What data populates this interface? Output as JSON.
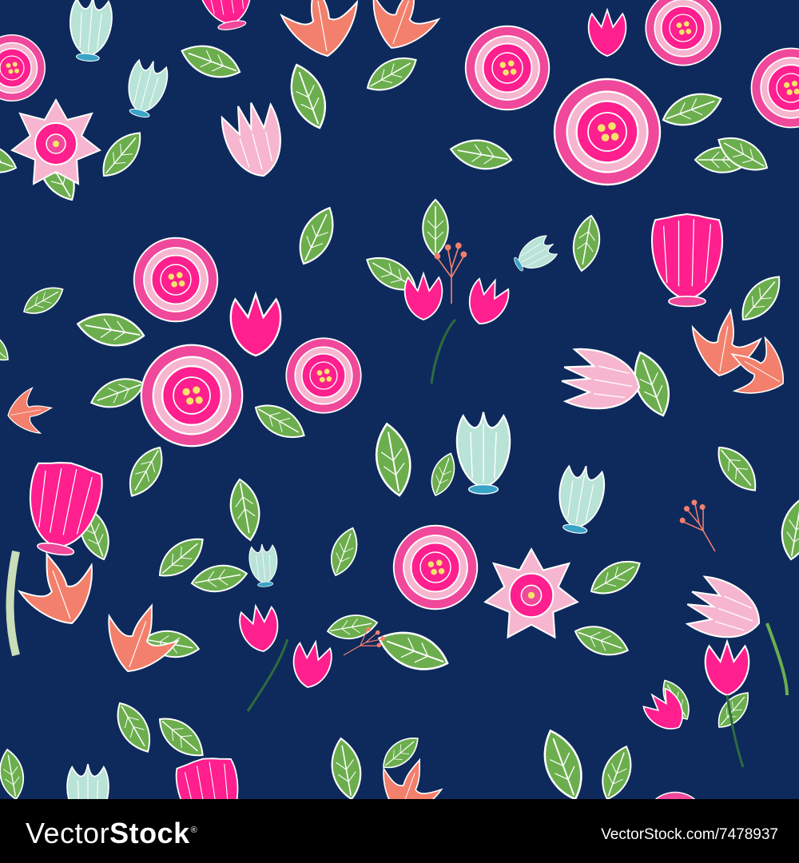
{
  "image": {
    "subject": "seamless floral pattern",
    "background_color": "#0e2a5c",
    "palette": {
      "hot_pink": "#ff1f8e",
      "rose": "#f0489a",
      "light_pink": "#f7b6cf",
      "salmon": "#f3806c",
      "mint": "#b8e3d6",
      "leaf_green": "#6cae4e",
      "dark_green": "#2f6b3e",
      "yellow": "#f7e36c",
      "outline": "#ffffff"
    }
  },
  "watermark": {
    "brand_prefix": "Vector",
    "brand_suffix": "Stock",
    "trademark": "®",
    "url": "VectorStock.com/7478937",
    "bar_color": "#000000",
    "text_color": "#ffffff"
  }
}
